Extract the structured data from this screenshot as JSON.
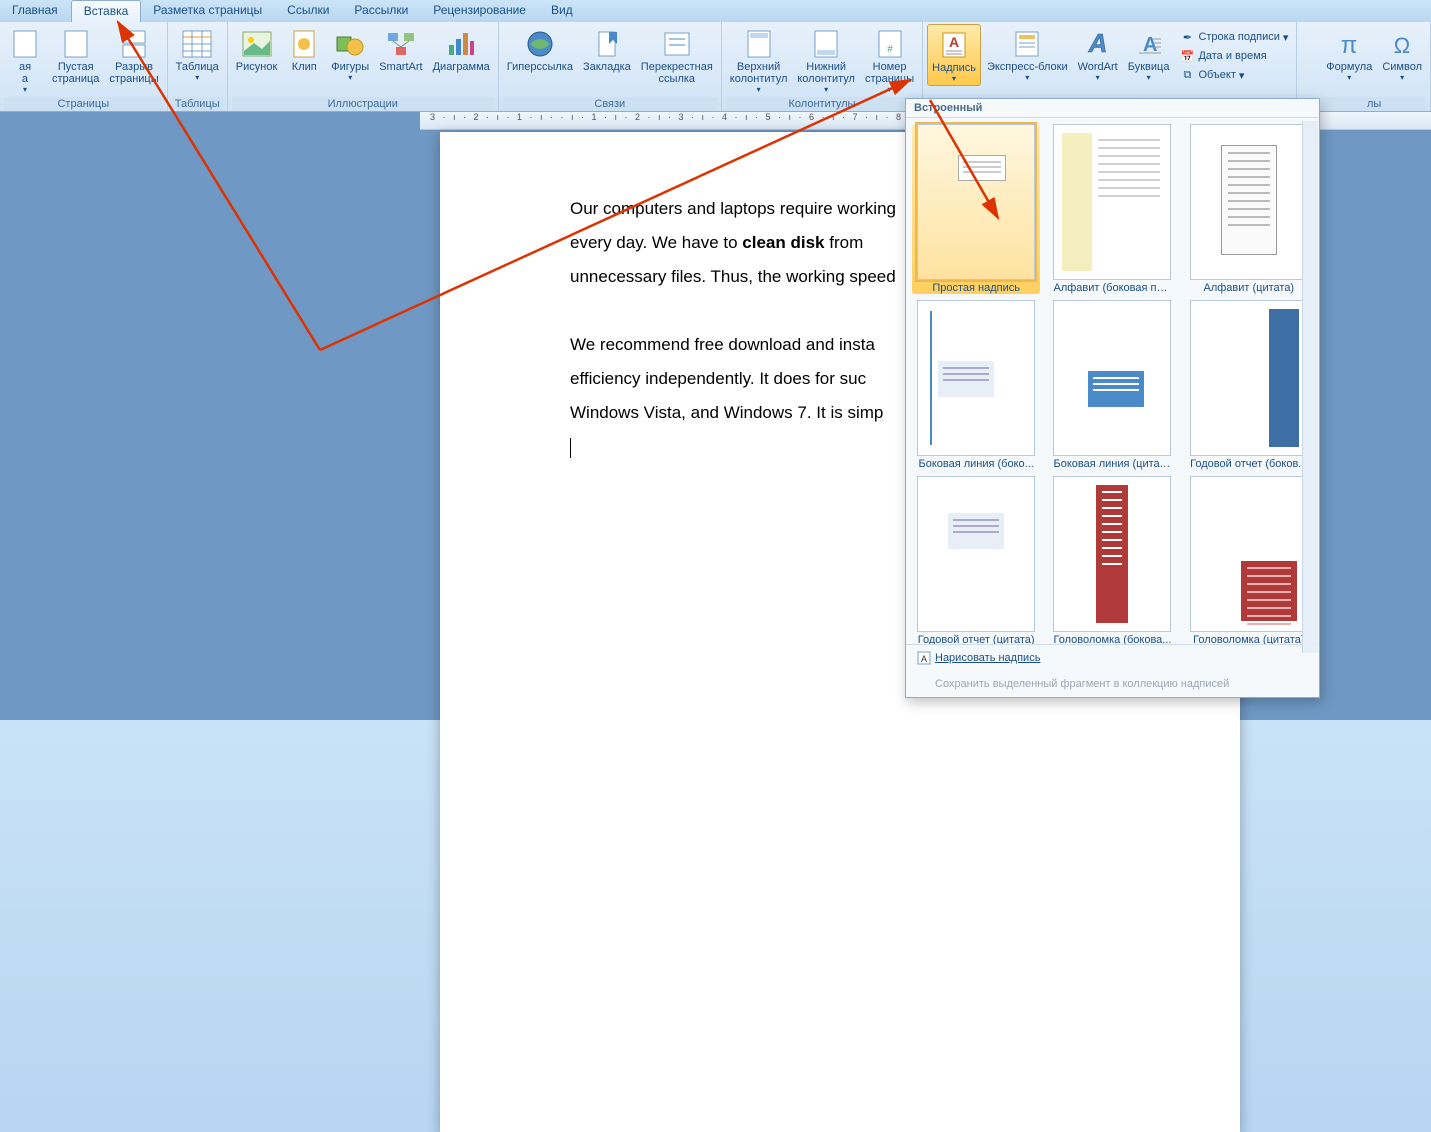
{
  "tabs": {
    "items": [
      "Главная",
      "Вставка",
      "Разметка страницы",
      "Ссылки",
      "Рассылки",
      "Рецензирование",
      "Вид"
    ],
    "active_index": 1
  },
  "ribbon": {
    "pages_group": {
      "label": "Страницы",
      "cover_label": "ая\nа",
      "blank_label": "Пустая\nстраница",
      "break_label": "Разрыв\nстраницы"
    },
    "tables_group": {
      "label": "Таблицы",
      "table_label": "Таблица"
    },
    "illus_group": {
      "label": "Иллюстрации",
      "picture_label": "Рисунок",
      "clip_label": "Клип",
      "shapes_label": "Фигуры",
      "smartart_label": "SmartArt",
      "chart_label": "Диаграмма"
    },
    "links_group": {
      "label": "Связи",
      "hyper_label": "Гиперссылка",
      "bookmark_label": "Закладка",
      "crossref_label": "Перекрестная\nссылка"
    },
    "hf_group": {
      "label": "Колонтитулы",
      "header_label": "Верхний\nколонтитул",
      "footer_label": "Нижний\nколонтитул",
      "pagenum_label": "Номер\nстраницы"
    },
    "text_group": {
      "textbox_label": "Надпись",
      "quick_label": "Экспресс-блоки",
      "wordart_label": "WordArt",
      "dropcap_label": "Буквица",
      "sig_label": "Строка подписи",
      "date_label": "Дата и время",
      "object_label": "Объект"
    },
    "symbols_group": {
      "label": "лы",
      "formula_label": "Формула",
      "symbol_label": "Символ"
    }
  },
  "gallery": {
    "header": "Встроенный",
    "items": [
      {
        "caption": "Простая надпись",
        "kind": "simple"
      },
      {
        "caption": "Алфавит (боковая по...",
        "kind": "side-yellow"
      },
      {
        "caption": "Алфавит (цитата)",
        "kind": "quote-box"
      },
      {
        "caption": "Боковая линия (боко...",
        "kind": "side-line"
      },
      {
        "caption": "Боковая линия (цитата)",
        "kind": "quote-blue"
      },
      {
        "caption": "Годовой отчет (боков...",
        "kind": "annual-side"
      },
      {
        "caption": "Годовой отчет (цитата)",
        "kind": "annual-quote"
      },
      {
        "caption": "Головоломка (бокова...",
        "kind": "puzzle-side"
      },
      {
        "caption": "Головоломка (цитата)",
        "kind": "puzzle-quote"
      }
    ],
    "draw_label": "Нарисовать надпись",
    "save_label": "Сохранить выделенный фрагмент в коллекцию надписей"
  },
  "document": {
    "p1a": "Our computers and laptops require working",
    "p1b": "every day. We have to ",
    "p1bold": "clean disk",
    "p1c": " from",
    "p1d": "unnecessary files. Thus, the working speed",
    "p2a": "We recommend free download and insta",
    "p2b": "efficiency independently. It does for suc",
    "p2c": "Windows Vista, and Windows 7. It is simp"
  },
  "ruler_text": "3 · ı · 2 · ı · 1 · ı ·   · ı · 1 · ı · 2 · ı · 3 · ı · 4 · ı · 5 · ı · 6 · ı · 7 · ı · 8 · ı · 9"
}
